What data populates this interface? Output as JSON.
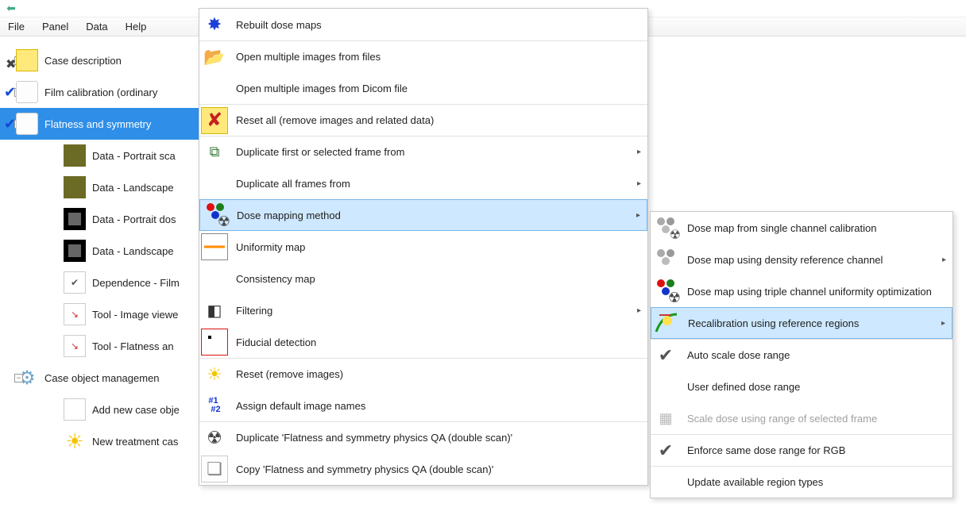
{
  "menubar": {
    "file": "File",
    "panel": "Panel",
    "data": "Data",
    "help": "Help"
  },
  "tree": {
    "items": [
      {
        "label": "Case description"
      },
      {
        "label": "Film calibration (ordinary"
      },
      {
        "label": "Flatness and symmetry"
      },
      {
        "label": "Data - Portrait sca"
      },
      {
        "label": "Data - Landscape"
      },
      {
        "label": "Data - Portrait dos"
      },
      {
        "label": "Data - Landscape"
      },
      {
        "label": "Dependence - Film"
      },
      {
        "label": "Tool - Image viewe"
      },
      {
        "label": "Tool - Flatness an"
      },
      {
        "label": "Case object managemen"
      },
      {
        "label": "Add new case obje"
      },
      {
        "label": "New treatment cas"
      }
    ]
  },
  "menu1": {
    "items": [
      "Rebuilt dose maps",
      "Open multiple images from files",
      "Open multiple images from Dicom file",
      "Reset all (remove images and related data)",
      "Duplicate first or selected frame from",
      "Duplicate all frames from",
      "Dose mapping method",
      "Uniformity map",
      "Consistency map",
      "Filtering",
      "Fiducial detection",
      "Reset (remove images)",
      "Assign default image names",
      "Duplicate 'Flatness and symmetry physics QA (double scan)'",
      "Copy 'Flatness and symmetry physics QA (double scan)'"
    ]
  },
  "menu2": {
    "items": [
      "Dose map from single channel calibration",
      "Dose map using density reference channel",
      "Dose map using triple channel uniformity optimization",
      "Recalibration using reference regions",
      "Auto scale dose range",
      "User defined dose range",
      "Scale dose using range of selected frame",
      "Enforce same dose range for RGB",
      "Update available region types"
    ]
  }
}
